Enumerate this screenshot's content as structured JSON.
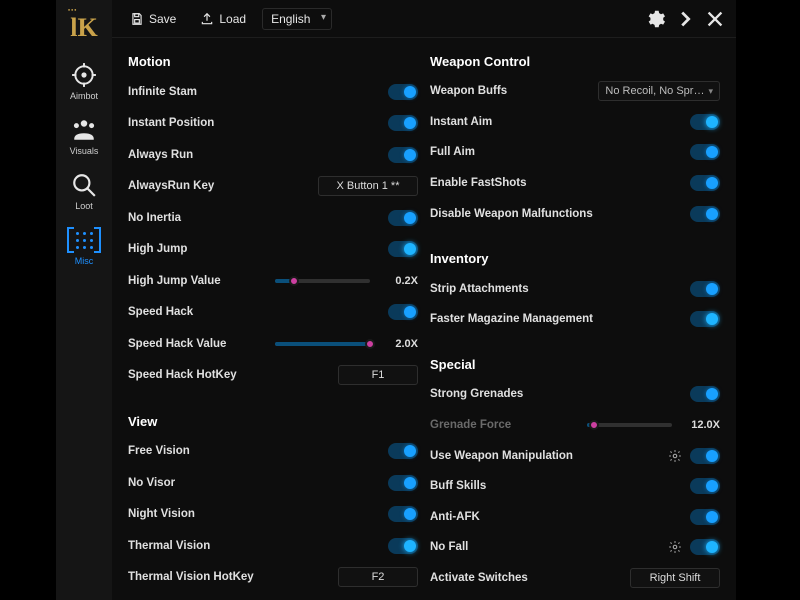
{
  "topbar": {
    "save_label": "Save",
    "load_label": "Load",
    "language": "English"
  },
  "sidebar": {
    "items": [
      {
        "label": "Aimbot"
      },
      {
        "label": "Visuals"
      },
      {
        "label": "Loot"
      },
      {
        "label": "Misc"
      }
    ]
  },
  "sections": {
    "motion": {
      "title": "Motion",
      "infinite_stam": "Infinite Stam",
      "instant_position": "Instant Position",
      "always_run": "Always Run",
      "always_run_key_label": "AlwaysRun Key",
      "always_run_key_value": "X Button 1 **",
      "no_inertia": "No Inertia",
      "high_jump": "High Jump",
      "high_jump_value_label": "High Jump Value",
      "high_jump_value": "0.2X",
      "speed_hack": "Speed Hack",
      "speed_hack_value_label": "Speed Hack Value",
      "speed_hack_value": "2.0X",
      "speed_hack_hotkey_label": "Speed Hack HotKey",
      "speed_hack_hotkey_value": "F1"
    },
    "view": {
      "title": "View",
      "free_vision": "Free Vision",
      "no_visor": "No Visor",
      "night_vision": "Night Vision",
      "thermal_vision": "Thermal Vision",
      "thermal_hotkey_label": "Thermal Vision HotKey",
      "thermal_hotkey_value": "F2"
    },
    "weapon": {
      "title": "Weapon Control",
      "weapon_buffs_label": "Weapon Buffs",
      "weapon_buffs_value": "No Recoil, No Spr…",
      "instant_aim": "Instant Aim",
      "full_aim": "Full Aim",
      "enable_fastshots": "Enable FastShots",
      "disable_malfunctions": "Disable Weapon Malfunctions"
    },
    "inventory": {
      "title": "Inventory",
      "strip_attachments": "Strip Attachments",
      "faster_mag": "Faster Magazine Management"
    },
    "special": {
      "title": "Special",
      "strong_grenades": "Strong Grenades",
      "grenade_force_label": "Grenade Force",
      "grenade_force_value": "12.0X",
      "use_weapon_manipulation": "Use Weapon Manipulation",
      "buff_skills": "Buff Skills",
      "anti_afk": "Anti-AFK",
      "no_fall": "No Fall",
      "activate_switches_label": "Activate Switches",
      "activate_switches_value": "Right Shift"
    }
  }
}
